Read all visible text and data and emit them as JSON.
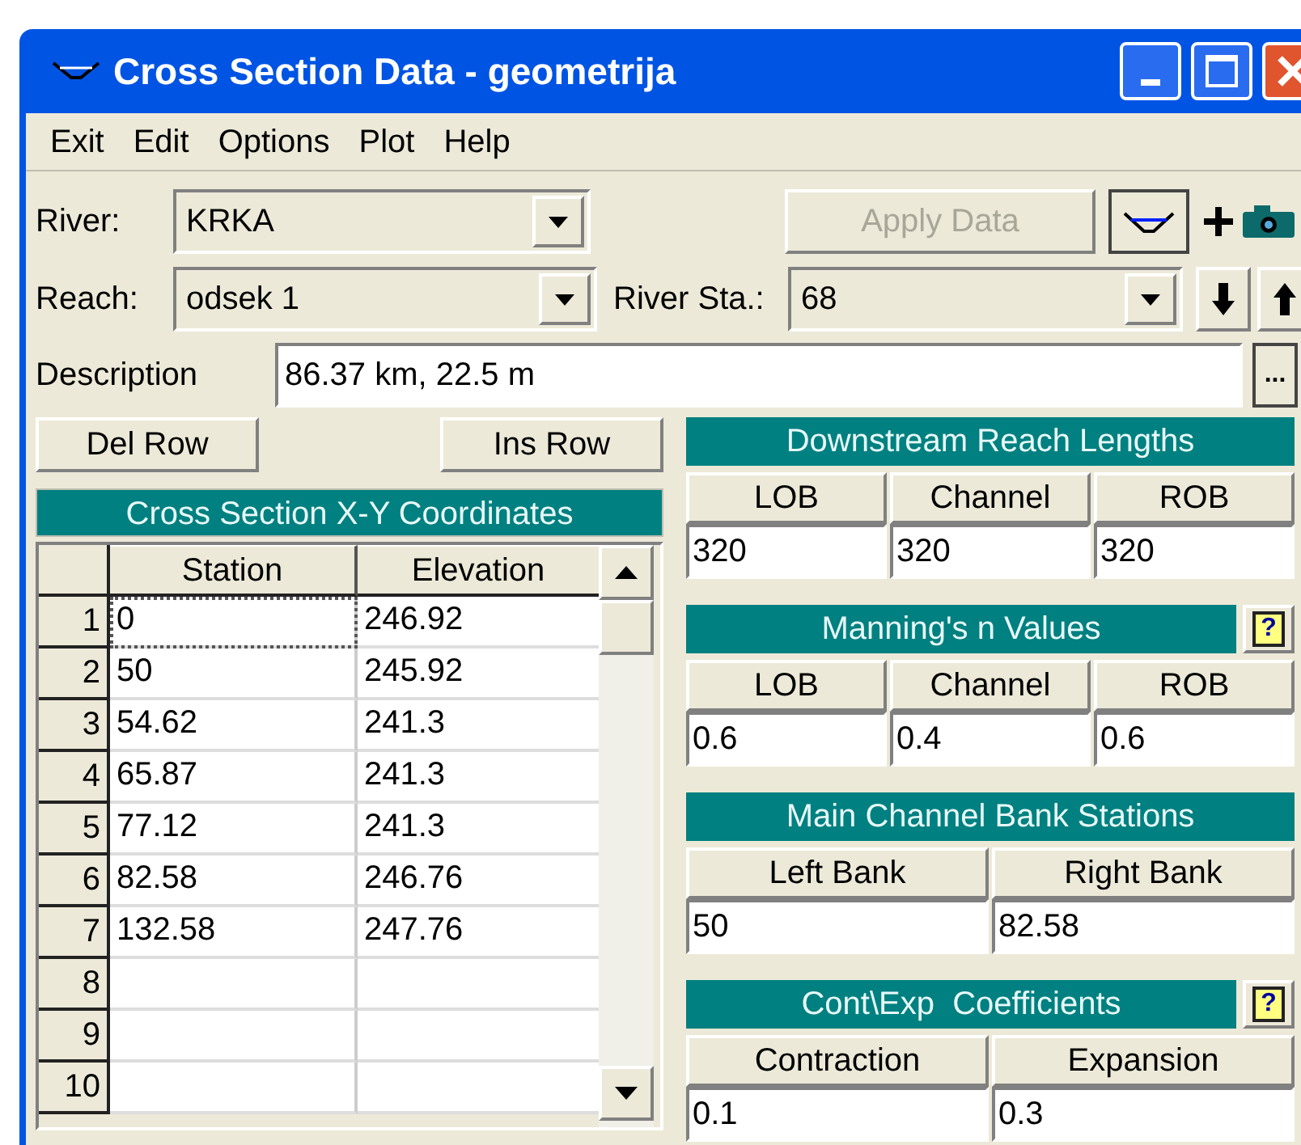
{
  "window": {
    "title": "Cross Section Data - geometrija"
  },
  "menu": [
    "Exit",
    "Edit",
    "Options",
    "Plot",
    "Help"
  ],
  "river": {
    "label": "River:",
    "value": "KRKA"
  },
  "apply_button": {
    "label": "Apply Data",
    "disabled": true
  },
  "reach": {
    "label": "Reach:",
    "value": "odsek 1"
  },
  "river_station": {
    "label": "River Sta.:",
    "value": "68"
  },
  "description": {
    "label": "Description",
    "value": "86.37 km, 22.5 m"
  },
  "more_button": "...",
  "row_buttons": [
    "Del Row",
    "Ins Row"
  ],
  "coordinates": {
    "title": "Cross Section X-Y Coordinates",
    "columns": [
      "Station",
      "Elevation"
    ],
    "rows": [
      {
        "number": "1",
        "cells": [
          "0",
          "246.92"
        ],
        "selected": true
      },
      {
        "number": "2",
        "cells": [
          "50",
          "245.92"
        ],
        "selected": false
      },
      {
        "number": "3",
        "cells": [
          "54.62",
          "241.3"
        ],
        "selected": false
      },
      {
        "number": "4",
        "cells": [
          "65.87",
          "241.3"
        ],
        "selected": false
      },
      {
        "number": "5",
        "cells": [
          "77.12",
          "241.3"
        ],
        "selected": false
      },
      {
        "number": "6",
        "cells": [
          "82.58",
          "246.76"
        ],
        "selected": false
      },
      {
        "number": "7",
        "cells": [
          "132.58",
          "247.76"
        ],
        "selected": false
      },
      {
        "number": "8",
        "cells": [],
        "selected": false
      },
      {
        "number": "9",
        "cells": [],
        "selected": false
      },
      {
        "number": "10",
        "cells": [],
        "selected": false
      }
    ]
  },
  "sections": [
    {
      "title": "Downstream Reach Lengths",
      "columns": [
        "LOB",
        "Channel",
        "ROB"
      ],
      "values": [
        "320",
        "320",
        "320"
      ]
    },
    {
      "title": "Manning's n Values",
      "help": "?",
      "columns": [
        "LOB",
        "Channel",
        "ROB"
      ],
      "values": [
        "0.6",
        "0.4",
        "0.6"
      ]
    },
    {
      "title": "Main Channel Bank Stations",
      "columns": [
        "Left Bank",
        "Right Bank"
      ],
      "values": [
        "50",
        "82.58"
      ]
    },
    {
      "title": "Cont\\Exp  Coefficients",
      "help": "?",
      "columns": [
        "Contraction",
        "Expansion"
      ],
      "values": [
        "0.1",
        "0.3"
      ]
    }
  ]
}
